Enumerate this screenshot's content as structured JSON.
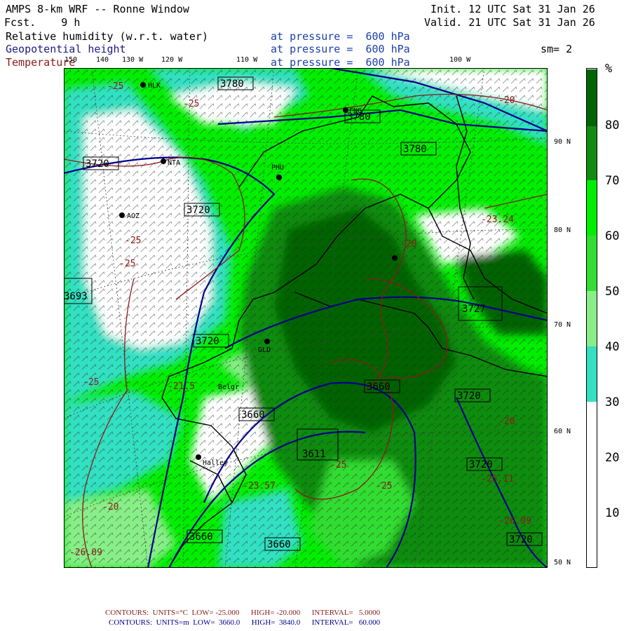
{
  "header": {
    "title": "AMPS 8-km WRF -- Ronne Window",
    "init": "Init. 12 UTC Sat 31 Jan 26",
    "fcst": "Fcst.    9 h",
    "valid": "Valid. 21 UTC Sat 31 Jan 26",
    "fields": [
      {
        "name": "Relative humidity (w.r.t. water)",
        "level": "at pressure =  600 hPa",
        "color": "#000000"
      },
      {
        "name": "Geopotential height",
        "level": "at pressure =  600 hPa",
        "color": "#1a1a8c"
      },
      {
        "name": "Temperature",
        "level": "at pressure =  600 hPa",
        "color": "#8b1a1a"
      }
    ],
    "sm": "sm= 2"
  },
  "map": {
    "lon_labels": [
      "150",
      "140",
      "130 W",
      "120 W",
      "110 W",
      "100 W"
    ],
    "lat_labels": [
      "90 N",
      "80 N",
      "70 N",
      "60 N",
      "50 N"
    ],
    "stations": [
      "HLK",
      "FNG",
      "PHU",
      "NTA",
      "AOZ",
      "GLD",
      "Belgr",
      "Halley"
    ],
    "height_labels": [
      "3780",
      "3780",
      "3780",
      "3720",
      "3720",
      "3720",
      "3720",
      "3720",
      "3720",
      "3693",
      "3727",
      "3660",
      "3660",
      "3660",
      "3660",
      "3611",
      "3780"
    ],
    "temp_labels": [
      "-25",
      "-25",
      "-20",
      "-25",
      "-25",
      "-25",
      "-25",
      "-20",
      "-23.24",
      "-21.5",
      "-23.57",
      "-25",
      "-26.09",
      "-20",
      "-26.09",
      "-20",
      "-25.11"
    ],
    "colors": {
      "land_boundary": "#000000",
      "height_contour": "#00008b",
      "temp_contour": "#8b1a1a"
    }
  },
  "colorbar": {
    "unit": "%",
    "ticks": [
      "80",
      "70",
      "60",
      "50",
      "40",
      "30",
      "20",
      "10"
    ],
    "bins": [
      {
        "color": "#ffffff"
      },
      {
        "color": "#ffffff"
      },
      {
        "color": "#ffffff"
      },
      {
        "color": "#33e0c2"
      },
      {
        "color": "#88ef88"
      },
      {
        "color": "#33dd33"
      },
      {
        "color": "#00ee00"
      },
      {
        "color": "#118c11"
      },
      {
        "color": "#006400"
      }
    ]
  },
  "footer": {
    "line1": "CONTOURS:  UNITS=°C  LOW= -25.000      HIGH= -20.000      INTERVAL=   5.0000",
    "line2": "CONTOURS:  UNITS=m  LOW=  3660.0      HIGH=  3840.0      INTERVAL=   60.000"
  }
}
